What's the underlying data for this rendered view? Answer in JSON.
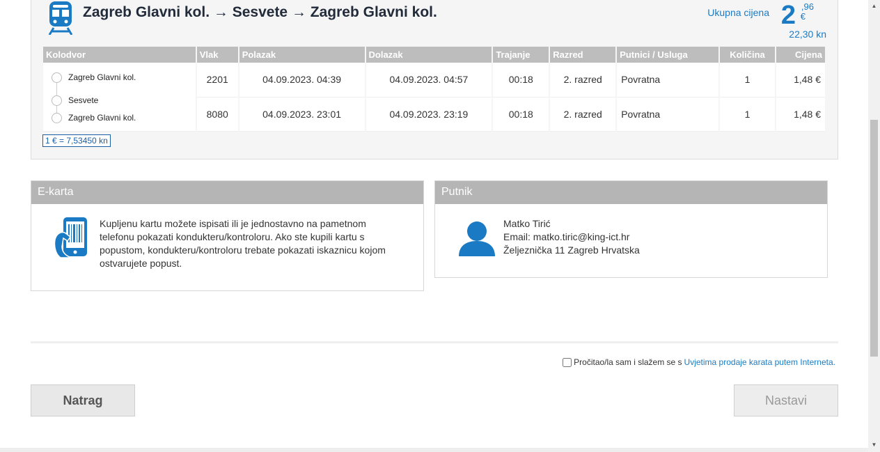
{
  "route": {
    "title": "Zagreb Glavni kol. → Sesvete → Zagreb Glavni kol.",
    "icon": "train-icon"
  },
  "price": {
    "label": "Ukupna cijena",
    "integer": "2",
    "cents": ",96",
    "currency": "€",
    "kn": "22,30 kn"
  },
  "table": {
    "headers": [
      "Kolodvor",
      "Vlak",
      "Polazak",
      "Dolazak",
      "Trajanje",
      "Razred",
      "Putnici / Usluga",
      "Količina",
      "Cijena"
    ],
    "stations": [
      "Zagreb Glavni kol.",
      "Sesvete",
      "Zagreb Glavni kol."
    ],
    "rows": [
      {
        "train": "2201",
        "departure": "04.09.2023. 04:39",
        "arrival": "04.09.2023. 04:57",
        "duration": "00:18",
        "class": "2. razred",
        "service": "Povratna",
        "qty": "1",
        "price": "1,48 €"
      },
      {
        "train": "8080",
        "departure": "04.09.2023. 23:01",
        "arrival": "04.09.2023. 23:19",
        "duration": "00:18",
        "class": "2. razred",
        "service": "Povratna",
        "qty": "1",
        "price": "1,48 €"
      }
    ]
  },
  "rate": "1 € = 7,53450 kn",
  "ekarta": {
    "title": "E-karta",
    "text": "Kupljenu kartu možete ispisati ili je jednostavno na pametnom telefonu pokazati kondukteru/kontroloru. Ako ste kupili kartu s popustom, kondukteru/kontroloru trebate pokazati iskaznicu kojom ostvarujete popust."
  },
  "putnik": {
    "title": "Putnik",
    "name": "Matko Tirić",
    "email": "Email: matko.tiric@king-ict.hr",
    "address": "Željeznička 11 Zagreb Hrvatska"
  },
  "agree": {
    "text": "Pročitao/la sam i slažem se s",
    "link": "Uvjetima prodaje karata putem Interneta."
  },
  "buttons": {
    "back": "Natrag",
    "next": "Nastavi"
  },
  "colors": {
    "accent": "#1a7bc4",
    "header_gray": "#b5b5b5"
  }
}
